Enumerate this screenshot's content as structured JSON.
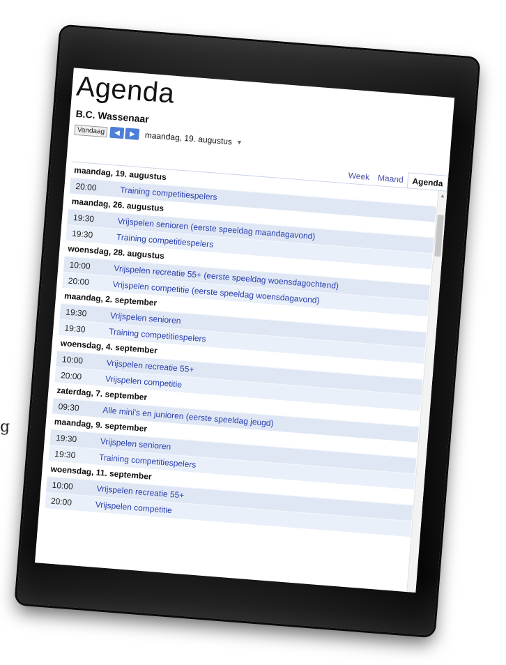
{
  "edge_text": "g",
  "page_title": "Agenda",
  "calendar_name": "B.C. Wassenaar",
  "nav": {
    "today_label": "Vandaag",
    "prev_icon": "◀",
    "next_icon": "▶",
    "current_date": "maandag, 19. augustus",
    "dropdown_icon": "▼"
  },
  "tabs": {
    "week": "Week",
    "month": "Maand",
    "agenda": "Agenda"
  },
  "days": [
    {
      "date": "maandag, 19. augustus",
      "events": [
        {
          "time": "20:00",
          "title": "Training competitiespelers"
        }
      ]
    },
    {
      "date": "maandag, 26. augustus",
      "events": [
        {
          "time": "19:30",
          "title": "Vrijspelen senioren (eerste speeldag maandagavond)"
        },
        {
          "time": "19:30",
          "title": "Training competitiespelers"
        }
      ]
    },
    {
      "date": "woensdag, 28. augustus",
      "events": [
        {
          "time": "10:00",
          "title": "Vrijspelen recreatie 55+ (eerste speeldag woensdagochtend)"
        },
        {
          "time": "20:00",
          "title": "Vrijspelen competitie (eerste speeldag woensdagavond)"
        }
      ]
    },
    {
      "date": "maandag, 2. september",
      "events": [
        {
          "time": "19:30",
          "title": "Vrijspelen senioren"
        },
        {
          "time": "19:30",
          "title": "Training competitiespelers"
        }
      ]
    },
    {
      "date": "woensdag, 4. september",
      "events": [
        {
          "time": "10:00",
          "title": "Vrijspelen recreatie 55+"
        },
        {
          "time": "20:00",
          "title": "Vrijspelen competitie"
        }
      ]
    },
    {
      "date": "zaterdag, 7. september",
      "events": [
        {
          "time": "09:30",
          "title": "Alle mini's en junioren (eerste speeldag jeugd)"
        }
      ]
    },
    {
      "date": "maandag, 9. september",
      "events": [
        {
          "time": "19:30",
          "title": "Vrijspelen senioren"
        },
        {
          "time": "19:30",
          "title": "Training competitiespelers"
        }
      ]
    },
    {
      "date": "woensdag, 11. september",
      "events": [
        {
          "time": "10:00",
          "title": "Vrijspelen recreatie 55+"
        },
        {
          "time": "20:00",
          "title": "Vrijspelen competitie"
        }
      ]
    }
  ]
}
